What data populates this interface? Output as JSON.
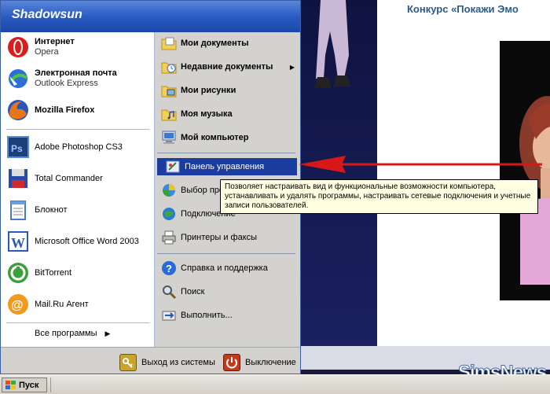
{
  "window": {
    "user_name": "Shadowsun"
  },
  "background": {
    "page_title": "Конкурс «Покажи Эмо",
    "watermark": "SimsNews"
  },
  "pinned": [
    {
      "id": "internet",
      "title": "Интернет",
      "subtitle": "Opera",
      "icon": "opera-icon"
    },
    {
      "id": "email",
      "title": "Электронная почта",
      "subtitle": "Outlook Express",
      "icon": "outlook-express-icon"
    },
    {
      "id": "firefox",
      "title": "Mozilla Firefox",
      "subtitle": "",
      "icon": "firefox-icon"
    }
  ],
  "recent": [
    {
      "id": "photoshop",
      "title": "Adobe Photoshop CS3",
      "icon": "photoshop-icon"
    },
    {
      "id": "totalcmd",
      "title": "Total Commander",
      "icon": "total-commander-icon"
    },
    {
      "id": "notepad",
      "title": "Блокнот",
      "icon": "notepad-icon"
    },
    {
      "id": "word",
      "title": "Microsoft Office Word 2003",
      "icon": "word-icon"
    },
    {
      "id": "bittorrent",
      "title": "BitTorrent",
      "icon": "bittorrent-icon"
    },
    {
      "id": "mailru",
      "title": "Mail.Ru Агент",
      "icon": "mailru-agent-icon"
    }
  ],
  "all_programs": "Все программы",
  "right": [
    {
      "id": "my-documents",
      "title": "Мои документы",
      "bold": true,
      "icon": "folder-documents-icon",
      "submenu": false
    },
    {
      "id": "recent-documents",
      "title": "Недавние документы",
      "bold": true,
      "icon": "recent-documents-icon",
      "submenu": true
    },
    {
      "id": "my-pictures",
      "title": "Мои рисунки",
      "bold": true,
      "icon": "folder-pictures-icon",
      "submenu": false
    },
    {
      "id": "my-music",
      "title": "Моя музыка",
      "bold": true,
      "icon": "folder-music-icon",
      "submenu": false
    },
    {
      "id": "my-computer",
      "title": "Мой компьютер",
      "bold": true,
      "icon": "computer-icon",
      "submenu": false
    },
    {
      "id": "control-panel",
      "title": "Панель управления",
      "bold": false,
      "icon": "control-panel-icon",
      "submenu": false,
      "selected": true
    },
    {
      "id": "default-programs",
      "title": "Выбор программ по умолчанию",
      "bold": false,
      "icon": "default-programs-icon",
      "submenu": false
    },
    {
      "id": "connections",
      "title": "Подключение",
      "bold": false,
      "icon": "network-connections-icon",
      "submenu": false
    },
    {
      "id": "printers",
      "title": "Принтеры и факсы",
      "bold": false,
      "icon": "printer-icon",
      "submenu": false
    },
    {
      "id": "help",
      "title": "Справка и поддержка",
      "bold": false,
      "icon": "help-icon",
      "submenu": false
    },
    {
      "id": "search",
      "title": "Поиск",
      "bold": false,
      "icon": "search-icon",
      "submenu": false
    },
    {
      "id": "run",
      "title": "Выполнить...",
      "bold": false,
      "icon": "run-icon",
      "submenu": false
    }
  ],
  "footer": {
    "logoff": "Выход из системы",
    "shutdown": "Выключение"
  },
  "tooltip": {
    "text": "Позволяет настраивать вид и функциональные возможности компьютера, устанавливать и удалять программы, настраивать сетевые подключения и учетные записи пользователей."
  },
  "taskbar": {
    "start_label": "Пуск"
  }
}
